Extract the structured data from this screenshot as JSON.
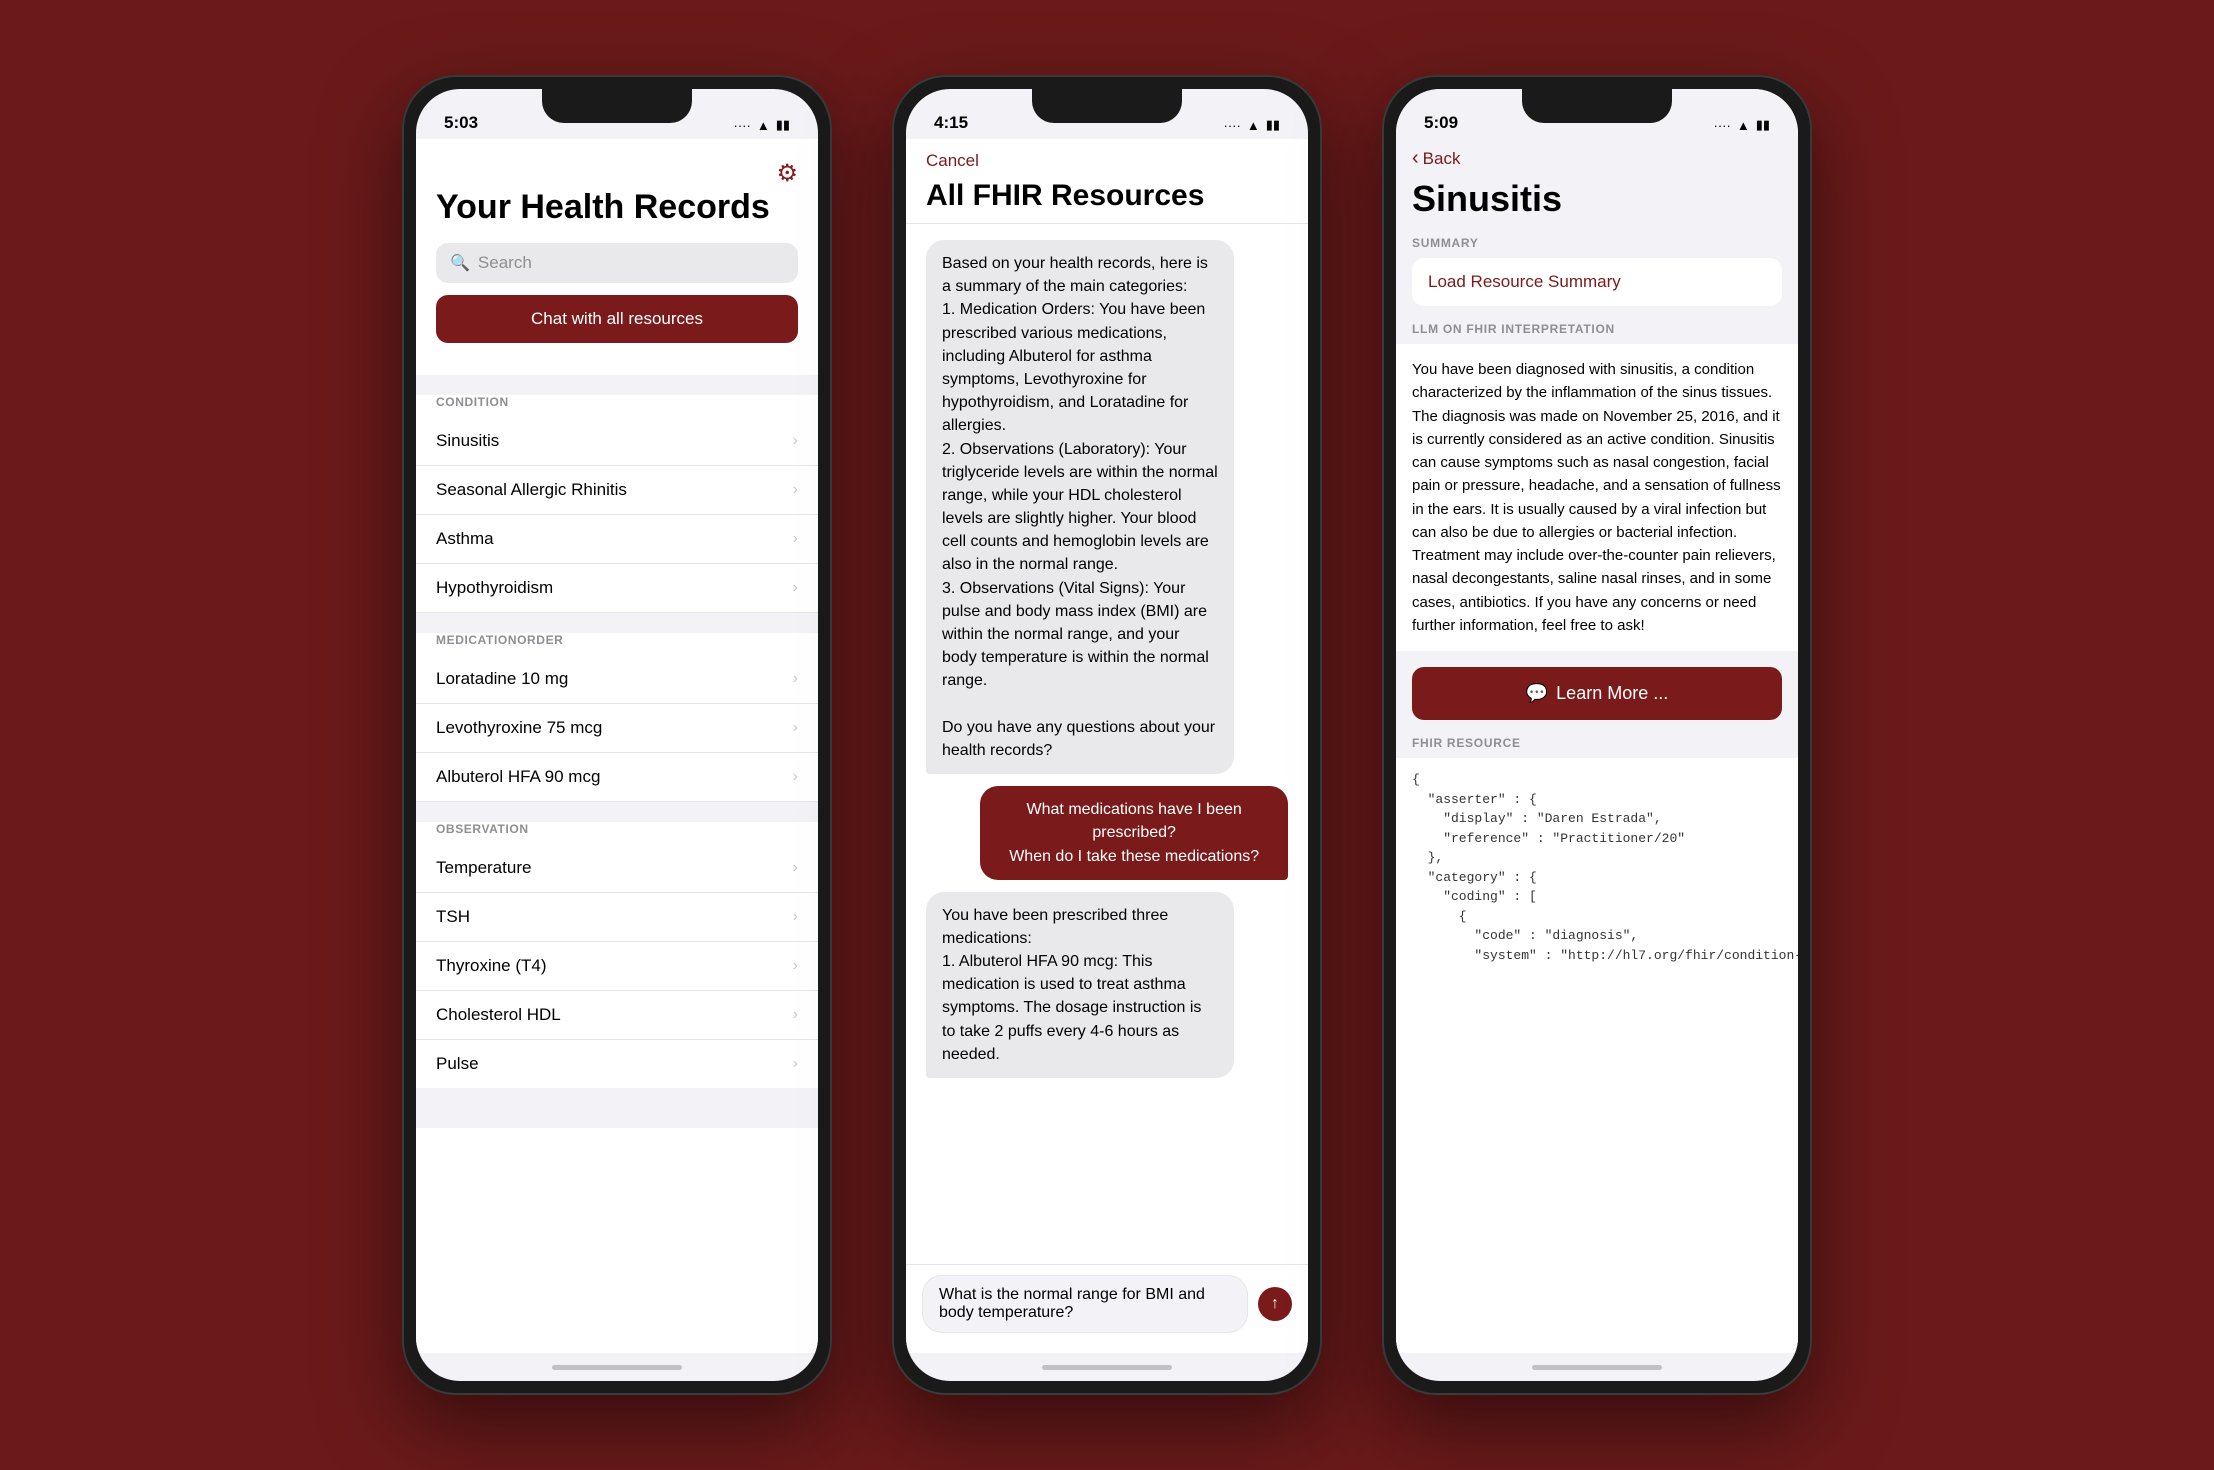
{
  "background_color": "#6B1A1A",
  "phone1": {
    "status_time": "5:03",
    "title": "Your Health Records",
    "search_placeholder": "Search",
    "chat_btn_label": "Chat with all resources",
    "settings_icon": "⚙",
    "sections": [
      {
        "label": "CONDITION",
        "items": [
          "Sinusitis",
          "Seasonal Allergic Rhinitis",
          "Asthma",
          "Hypothyroidism"
        ]
      },
      {
        "label": "MEDICATIONORDER",
        "items": [
          "Loratadine 10 mg",
          "Levothyroxine 75 mcg",
          "Albuterol HFA 90 mcg"
        ]
      },
      {
        "label": "OBSERVATION",
        "items": [
          "Temperature",
          "TSH",
          "Thyroxine (T4)",
          "Cholesterol HDL",
          "Pulse"
        ]
      }
    ]
  },
  "phone2": {
    "status_time": "4:15",
    "cancel_label": "Cancel",
    "title": "All FHIR Resources",
    "messages": [
      {
        "type": "ai",
        "text": "Based on your health records, here is a summary of the main categories:\n1. Medication Orders: You have been prescribed various medications, including Albuterol for asthma symptoms, Levothyroxine for hypothyroidism, and Loratadine for allergies.\n2. Observations (Laboratory): Your triglyceride levels are within the normal range, while your HDL cholesterol levels are slightly higher. Your blood cell counts and hemoglobin levels are also in the normal range.\n3. Observations (Vital Signs): Your pulse and body mass index (BMI) are within the normal range, and your body temperature is within the normal range.\n\nDo you have any questions about your health records?"
      },
      {
        "type": "user",
        "text": "What medications have I been prescribed?\nWhen do I take these medications?"
      },
      {
        "type": "ai",
        "text": "You have been prescribed three medications:\n1. Albuterol HFA 90 mcg: This medication is used to treat asthma symptoms. The dosage instruction is to take 2 puffs every 4-6 hours as needed."
      },
      {
        "type": "typing",
        "text": "What is the normal range for BMI and body temperature?"
      }
    ],
    "input_placeholder": "What is the normal range for BMI and body temperature?",
    "send_icon": "↑"
  },
  "phone3": {
    "status_time": "5:09",
    "back_label": "Back",
    "title": "Sinusitis",
    "summary_label": "SUMMARY",
    "load_resource_label": "Load Resource Summary",
    "llm_label": "LLM ON FHIR INTERPRETATION",
    "llm_text": "You have been diagnosed with sinusitis, a condition characterized by the inflammation of the sinus tissues. The diagnosis was made on November 25, 2016, and it is currently considered as an active condition. Sinusitis can cause symptoms such as nasal congestion, facial pain or pressure, headache, and a sensation of fullness in the ears. It is usually caused by a viral infection but can also be due to allergies or bacterial infection. Treatment may include over-the-counter pain relievers, nasal decongestants, saline nasal rinses, and in some cases, antibiotics. If you have any concerns or need further information, feel free to ask!",
    "learn_more_label": "Learn More ...",
    "fhir_label": "FHIR RESOURCE",
    "fhir_code": "{\n  \"asserter\" : {\n    \"display\" : \"Daren Estrada\",\n    \"reference\" : \"Practitioner/20\"\n  },\n  \"category\" : {\n    \"coding\" : [\n      {\n        \"code\" : \"diagnosis\",\n        \"system\" : \"http://hl7.org/fhir/condition-"
  }
}
